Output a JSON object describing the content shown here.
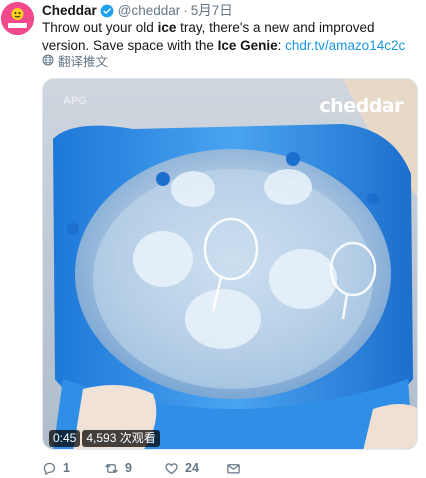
{
  "tweet": {
    "author_name": "Cheddar",
    "handle": "@cheddar",
    "separator": "·",
    "date": "5月7日",
    "text_1": "Throw out your old ",
    "text_bold_1": "ice",
    "text_2": " tray, there's a new and improved version. Save space with the ",
    "text_bold_2": "Ice Genie",
    "text_3": ": ",
    "link": "chdr.tv/amazo14c2c",
    "translate_label": "翻译推文"
  },
  "video": {
    "brand_watermark": "cheddar",
    "corner_watermark": "APG",
    "duration": "0:45",
    "views": "4,593 次观看"
  },
  "actions": {
    "reply_count": "1",
    "retweet_count": "9",
    "like_count": "24"
  },
  "colors": {
    "accent": "#1b95e0",
    "muted": "#657786",
    "avatar_bg": "#f04a8c",
    "ice_bucket_blue": "#2f8fe6"
  },
  "icons": {
    "verified": "verified-badge-icon",
    "translate": "globe-icon",
    "reply": "reply-icon",
    "retweet": "retweet-icon",
    "like": "heart-icon",
    "dm": "envelope-icon"
  }
}
